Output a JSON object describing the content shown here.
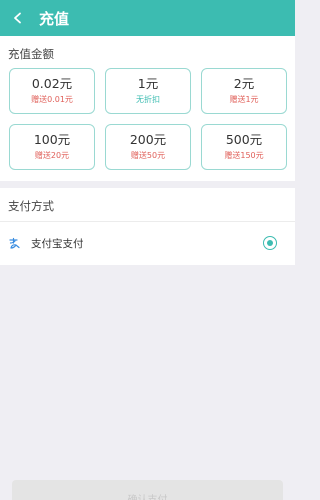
{
  "header": {
    "title": "充值"
  },
  "recharge": {
    "label": "充值金额",
    "options": [
      {
        "amount": "0.02元",
        "bonus": "赠送0.01元"
      },
      {
        "amount": "1元",
        "bonus": "无折扣"
      },
      {
        "amount": "2元",
        "bonus": "赠送1元"
      },
      {
        "amount": "100元",
        "bonus": "赠送20元"
      },
      {
        "amount": "200元",
        "bonus": "赠送50元"
      },
      {
        "amount": "500元",
        "bonus": "赠送150元"
      }
    ]
  },
  "payment": {
    "label": "支付方式",
    "method": "支付宝支付",
    "selected": true
  },
  "footer": {
    "confirm_label": "确认支付"
  },
  "colors": {
    "brand": "#3cbcb1",
    "bonus_text": "#e0605a",
    "card_border": "#9ad9d2",
    "page_bg": "#efeef3"
  }
}
